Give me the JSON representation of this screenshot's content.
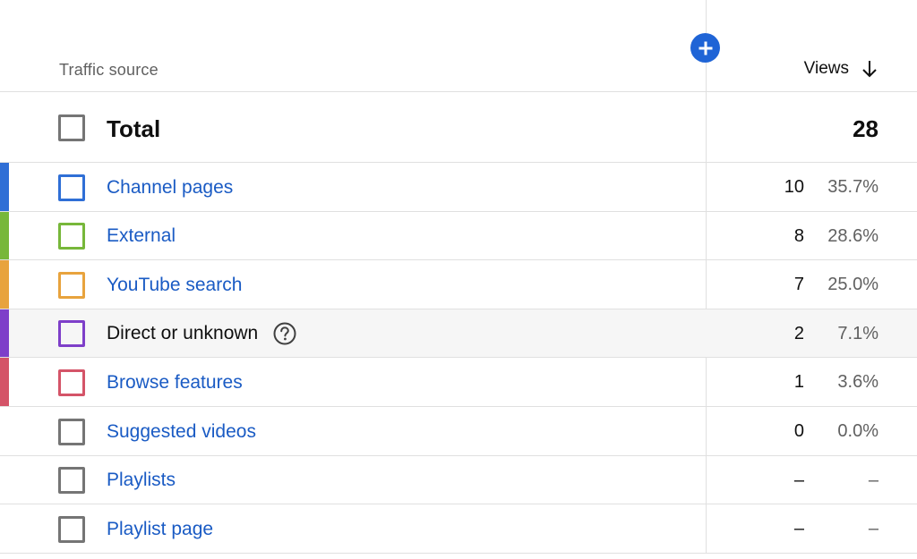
{
  "header": {
    "column_label": "Traffic source",
    "metric_label": "Views",
    "sort_icon": "arrow-down-icon",
    "add_icon": "plus-icon",
    "accent_color": "#1f64d6"
  },
  "total": {
    "label": "Total",
    "value": "28"
  },
  "rows": [
    {
      "label": "Channel pages",
      "value": "10",
      "percent": "35.7%",
      "color": "#2f6fd6",
      "is_link": true
    },
    {
      "label": "External",
      "value": "8",
      "percent": "28.6%",
      "color": "#77b73a",
      "is_link": true
    },
    {
      "label": "YouTube search",
      "value": "7",
      "percent": "25.0%",
      "color": "#e8a33d",
      "is_link": true
    },
    {
      "label": "Direct or unknown",
      "value": "2",
      "percent": "7.1%",
      "color": "#7e3fc9",
      "is_link": false,
      "help_icon": "help-circle-icon"
    },
    {
      "label": "Browse features",
      "value": "1",
      "percent": "3.6%",
      "color": "#d45468",
      "is_link": true
    },
    {
      "label": "Suggested videos",
      "value": "0",
      "percent": "0.0%",
      "color": "",
      "is_link": true
    },
    {
      "label": "Playlists",
      "value": "–",
      "percent": "–",
      "color": "",
      "is_link": true
    },
    {
      "label": "Playlist page",
      "value": "–",
      "percent": "–",
      "color": "",
      "is_link": true
    }
  ]
}
